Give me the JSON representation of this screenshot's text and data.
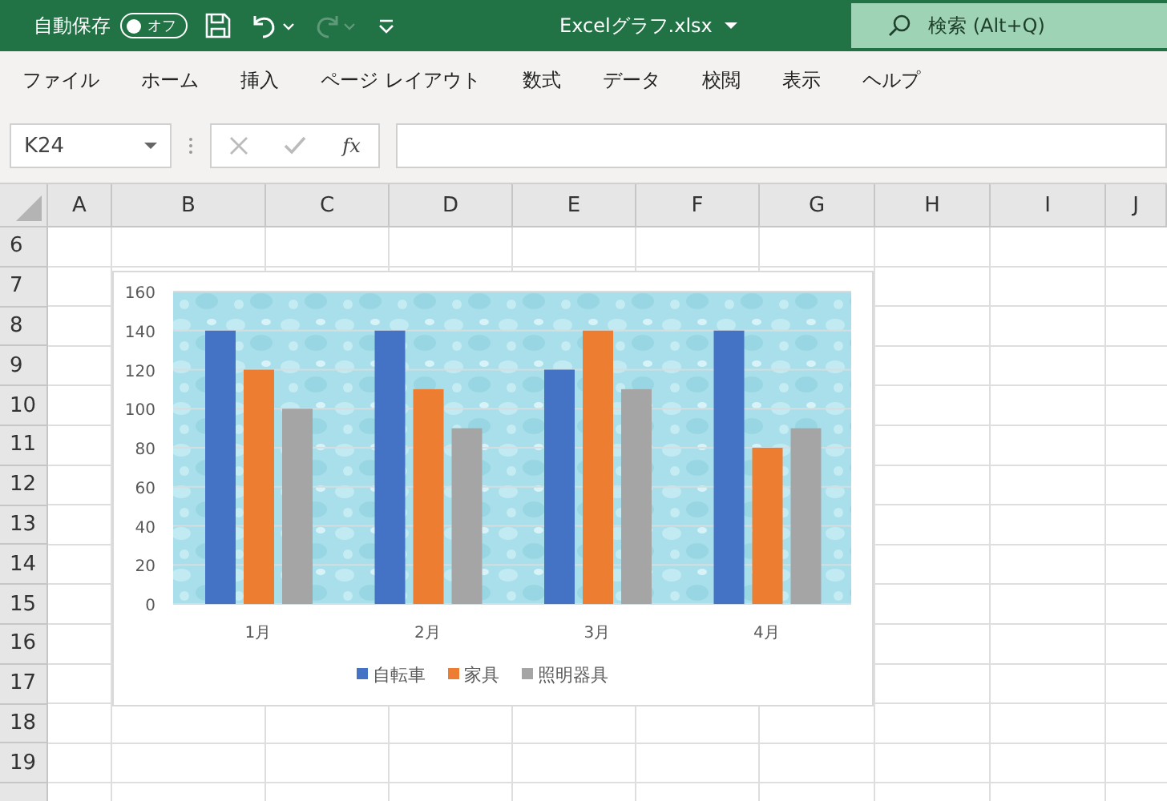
{
  "title_bar": {
    "autosave": {
      "label": "自動保存",
      "on": false,
      "state_label": "オフ"
    },
    "redo_disabled": true,
    "file_name": "Excelグラフ.xlsx",
    "search": {
      "placeholder": "検索 (Alt+Q)"
    }
  },
  "menu": [
    "ファイル",
    "ホーム",
    "挿入",
    "ページ レイアウト",
    "数式",
    "データ",
    "校閲",
    "表示",
    "ヘルプ"
  ],
  "formula_bar": {
    "name_box": "K24",
    "function_label": "fx"
  },
  "sheet": {
    "columns": [
      "A",
      "B",
      "C",
      "D",
      "E",
      "F",
      "G",
      "H",
      "I",
      "J"
    ],
    "rows": [
      "6",
      "7",
      "8",
      "9",
      "10",
      "11",
      "12",
      "13",
      "14",
      "15",
      "16",
      "17",
      "18",
      "19"
    ]
  },
  "chart": {
    "chart_data": {
      "type": "bar",
      "categories": [
        "1月",
        "2月",
        "3月",
        "4月"
      ],
      "series": [
        {
          "name": "自転車",
          "color": "#4472c4",
          "values": [
            140,
            140,
            120,
            140
          ]
        },
        {
          "name": "家具",
          "color": "#ed7d31",
          "values": [
            120,
            110,
            140,
            80
          ]
        },
        {
          "name": "照明器具",
          "color": "#a5a5a5",
          "values": [
            100,
            90,
            110,
            90
          ]
        }
      ],
      "grid": true,
      "legend": true,
      "ylim": [
        0,
        160
      ],
      "yticks": [
        0,
        20,
        40,
        60,
        80,
        100,
        120,
        140,
        160
      ]
    }
  }
}
